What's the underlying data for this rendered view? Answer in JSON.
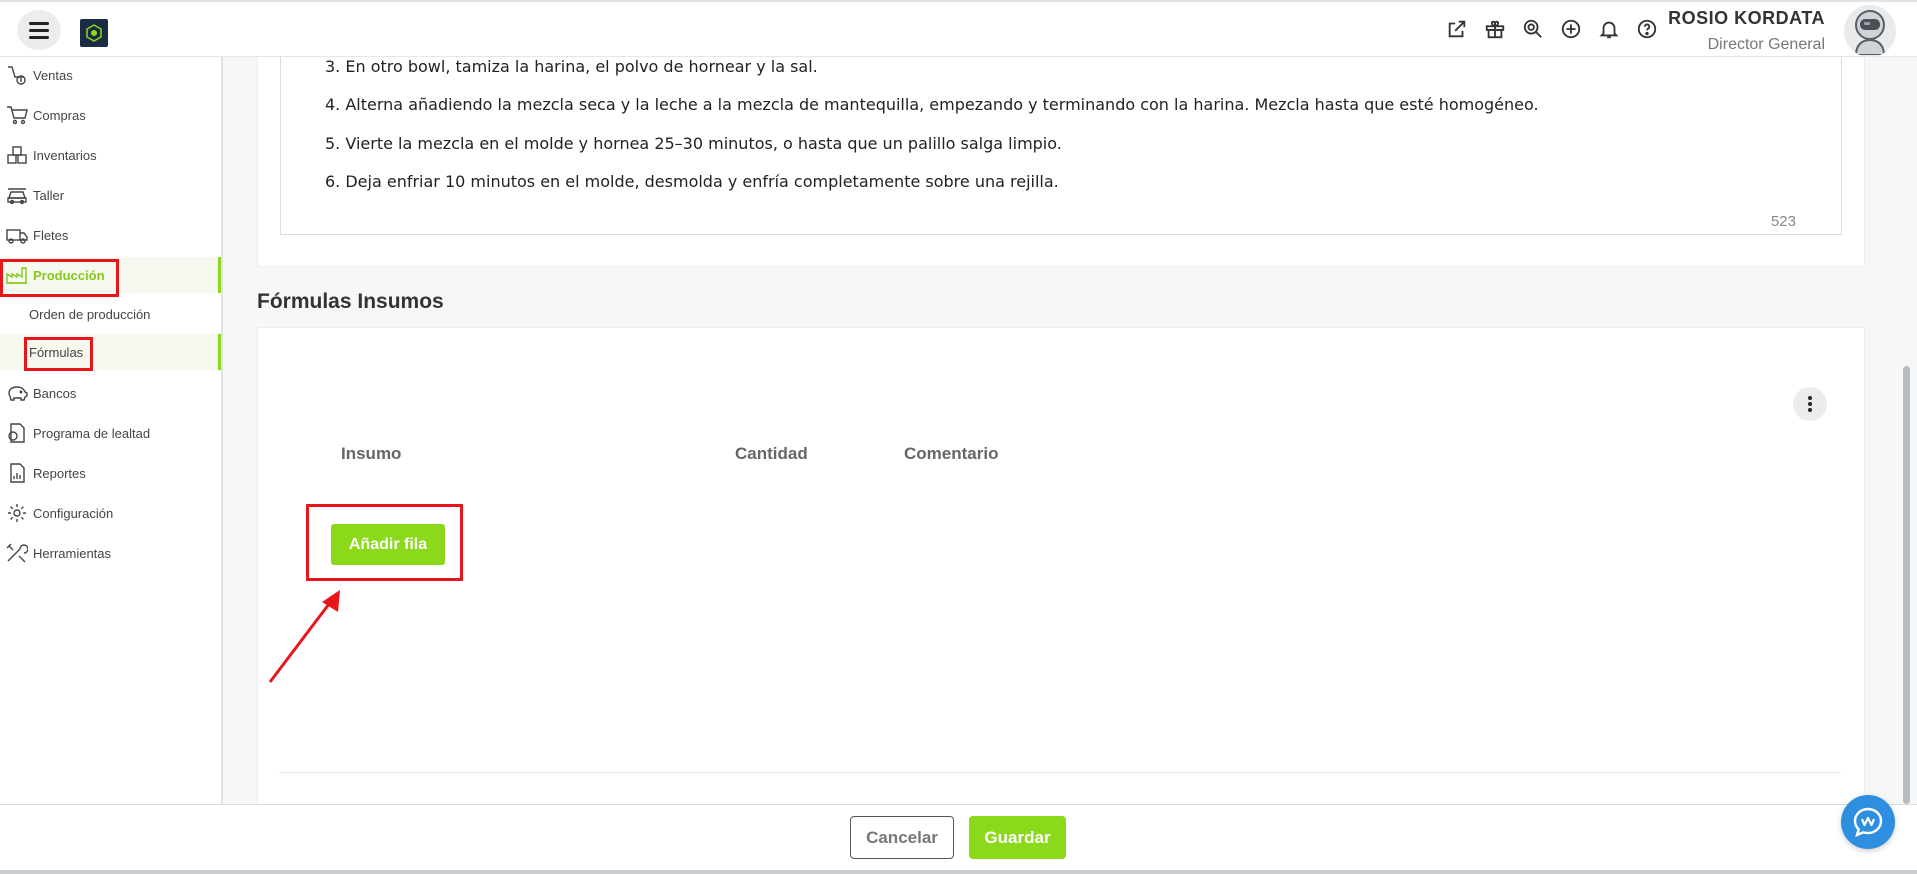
{
  "header": {
    "user_name": "ROSIO KORDATA",
    "user_role": "Director General",
    "icons": [
      "external-link-icon",
      "gift-icon",
      "search-zoom-icon",
      "plus-circle-icon",
      "bell-icon",
      "help-icon"
    ]
  },
  "sidebar": {
    "items": [
      {
        "label": "Ventas",
        "icon": "sales-icon"
      },
      {
        "label": "Compras",
        "icon": "cart-icon"
      },
      {
        "label": "Inventarios",
        "icon": "boxes-icon"
      },
      {
        "label": "Taller",
        "icon": "car-icon"
      },
      {
        "label": "Fletes",
        "icon": "truck-icon"
      },
      {
        "label": "Producción",
        "icon": "factory-icon",
        "active": true
      },
      {
        "label": "Bancos",
        "icon": "piggy-bank-icon"
      },
      {
        "label": "Programa de lealtad",
        "icon": "loyalty-icon"
      },
      {
        "label": "Reportes",
        "icon": "report-icon"
      },
      {
        "label": "Configuración",
        "icon": "gear-icon"
      },
      {
        "label": "Herramientas",
        "icon": "tools-icon"
      }
    ],
    "sub_items": [
      {
        "label": "Orden de producción"
      },
      {
        "label": "Fórmulas",
        "active": true
      }
    ]
  },
  "instructions": {
    "lines": [
      "3. En otro bowl, tamiza la harina, el polvo de hornear y la sal.",
      "4. Alterna añadiendo la mezcla seca y la leche a la mezcla de mantequilla, empezando y terminando con la harina. Mezcla hasta que esté homogéneo.",
      "5. Vierte la mezcla en el molde y hornea 25–30 minutos, o hasta que un palillo salga limpio.",
      "6. Deja enfriar 10 minutos en el molde, desmolda y enfría completamente sobre una rejilla."
    ],
    "char_count": "523"
  },
  "formulas": {
    "title": "Fórmulas Insumos",
    "columns": [
      "Insumo",
      "Cantidad",
      "Comentario"
    ],
    "add_row_label": "Añadir fila"
  },
  "footer": {
    "cancel_label": "Cancelar",
    "save_label": "Guardar"
  },
  "colors": {
    "accent": "#8cd81a",
    "highlight": "#e8161a",
    "chat": "#2e8fe0"
  }
}
